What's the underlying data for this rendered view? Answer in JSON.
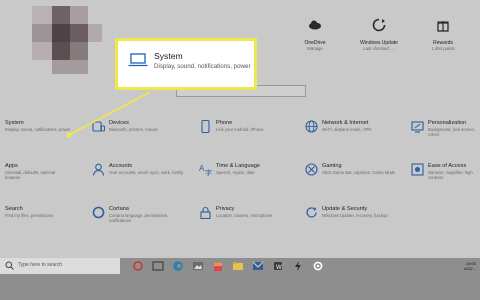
{
  "header": {
    "items": [
      {
        "title": "OneDrive",
        "sub": "Manage",
        "icon": "onedrive-icon"
      },
      {
        "title": "Windows Update",
        "sub": "Last checked: ...",
        "icon": "windows-update-icon"
      },
      {
        "title": "Rewards",
        "sub": "1,494 points",
        "icon": "rewards-icon"
      }
    ]
  },
  "search": {
    "placeholder": ""
  },
  "callout": {
    "title": "System",
    "desc": "Display, sound, notifications, power"
  },
  "categories": [
    {
      "label": "System",
      "desc": "Display, sound, notifications, power",
      "icon": "laptop-icon"
    },
    {
      "label": "Devices",
      "desc": "Bluetooth, printers, mouse",
      "icon": "devices-icon"
    },
    {
      "label": "Phone",
      "desc": "Link your Android, iPhone",
      "icon": "phone-icon"
    },
    {
      "label": "Network & Internet",
      "desc": "Wi-Fi, airplane mode, VPN",
      "icon": "globe-icon"
    },
    {
      "label": "Personalization",
      "desc": "Background, lock screen, colors",
      "icon": "personalization-icon"
    },
    {
      "label": "Apps",
      "desc": "Uninstall, defaults, optional features",
      "icon": "apps-icon"
    },
    {
      "label": "Accounts",
      "desc": "Your accounts, email, sync, work, family",
      "icon": "accounts-icon"
    },
    {
      "label": "Time & Language",
      "desc": "Speech, region, date",
      "icon": "time-language-icon"
    },
    {
      "label": "Gaming",
      "desc": "Xbox Game Bar, captures, Game Mode",
      "icon": "xbox-icon"
    },
    {
      "label": "Ease of Access",
      "desc": "Narrator, magnifier, high contrast",
      "icon": "ease-of-access-icon"
    },
    {
      "label": "Search",
      "desc": "Find my files, permissions",
      "icon": "search-icon"
    },
    {
      "label": "Cortana",
      "desc": "Cortana language, permissions, notifications",
      "icon": "cortana-icon"
    },
    {
      "label": "Privacy",
      "desc": "Location, camera, microphone",
      "icon": "lock-icon"
    },
    {
      "label": "Update & Security",
      "desc": "Windows Update, recovery, backup",
      "icon": "update-icon"
    }
  ],
  "taskbar": {
    "search_placeholder": "Type here to search",
    "apps": [
      "windows-icon",
      "cortana-icon",
      "task-view-icon",
      "edge-icon",
      "photos-icon",
      "store-icon",
      "settings-icon",
      "file-explorer-icon",
      "mail-icon",
      "app-icon",
      "settings-icon"
    ],
    "time": "10:00",
    "date": "4/22/..."
  }
}
